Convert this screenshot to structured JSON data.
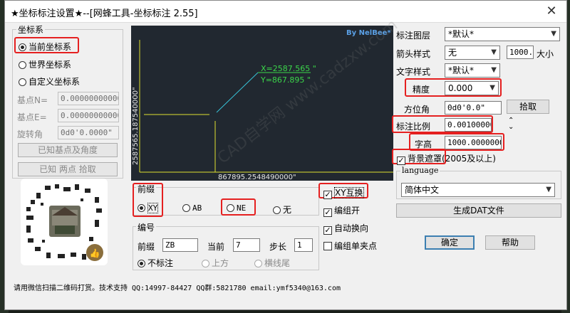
{
  "window": {
    "title": "★坐标标注设置★--[网蜂工具-坐标标注 2.55]",
    "close": "✕"
  },
  "coord_system": {
    "legend": "坐标系",
    "options": [
      "当前坐标系",
      "世界坐标系",
      "自定义坐标系"
    ],
    "selected": 0,
    "base_n_label": "基点N=",
    "base_n_value": "0.000000000000",
    "base_e_label": "基点E=",
    "base_e_value": "0.000000000000",
    "rotation_label": "旋转角",
    "rotation_value": "0d0'0.0000\"",
    "btn_known_base": "已知基点及角度",
    "btn_known_two": "已知 两点 拾取"
  },
  "preview": {
    "brand": "By NelBee*",
    "vertical_text": "2587565.187540000\"",
    "bottom_text": "867895.2548490000\"",
    "x_label": "X=2587.565 \"",
    "y_label": "Y=867.895 \""
  },
  "prefix": {
    "legend": "前缀",
    "options": [
      "XY",
      "AB",
      "NE",
      "无"
    ],
    "selected": 0
  },
  "numbering": {
    "legend": "编号",
    "prefix_label": "前缀",
    "prefix_value": "ZB",
    "current_label": "当前",
    "current_value": "7",
    "step_label": "步长",
    "step_value": "1",
    "options": [
      "不标注",
      "上方",
      "横线尾"
    ],
    "selected": 0
  },
  "checks": {
    "xy_swap": "XY互换",
    "group_on": "编组开",
    "auto_wrap": "自动换向",
    "group_single": "编组单夹点",
    "xy_swap_on": true,
    "group_on_on": true,
    "auto_wrap_on": true,
    "group_single_on": false
  },
  "right": {
    "layer_label": "标注图层",
    "layer_value": "*默认*",
    "arrow_label": "箭头样式",
    "arrow_value": "无",
    "size_value": "1000.0",
    "size_label": "大小",
    "text_style_label": "文字样式",
    "text_style_value": "*默认*",
    "precision_label": "精度",
    "precision_value": "0.000",
    "azimuth_label": "方位角",
    "azimuth_value": "0d0'0.0\"",
    "pick_btn": "拾取",
    "scale_label": "标注比例",
    "scale_value": "0.00100000",
    "height_label": "字高",
    "height_value": "1000.00000000",
    "mask_label": "背景遮罩",
    "mask_note": "(2005及以上)",
    "mask_on": true,
    "language_legend": "language",
    "language_value": "简体中文",
    "gen_btn": "生成DAT文件",
    "ok_btn": "确定",
    "help_btn": "帮助"
  },
  "status": "请用微信扫描二维码打赏。技术支持 QQ:14997-84427 QQ群:5821780 email:ymf5340@163.com",
  "watermark": "CAD自学网 www.cadzxw.com",
  "colors": {
    "highlight": "#e52020",
    "preview_bg": "#212830",
    "green": "#3bd64a",
    "cyan": "#37c3d8",
    "yellow": "#e0e030"
  }
}
